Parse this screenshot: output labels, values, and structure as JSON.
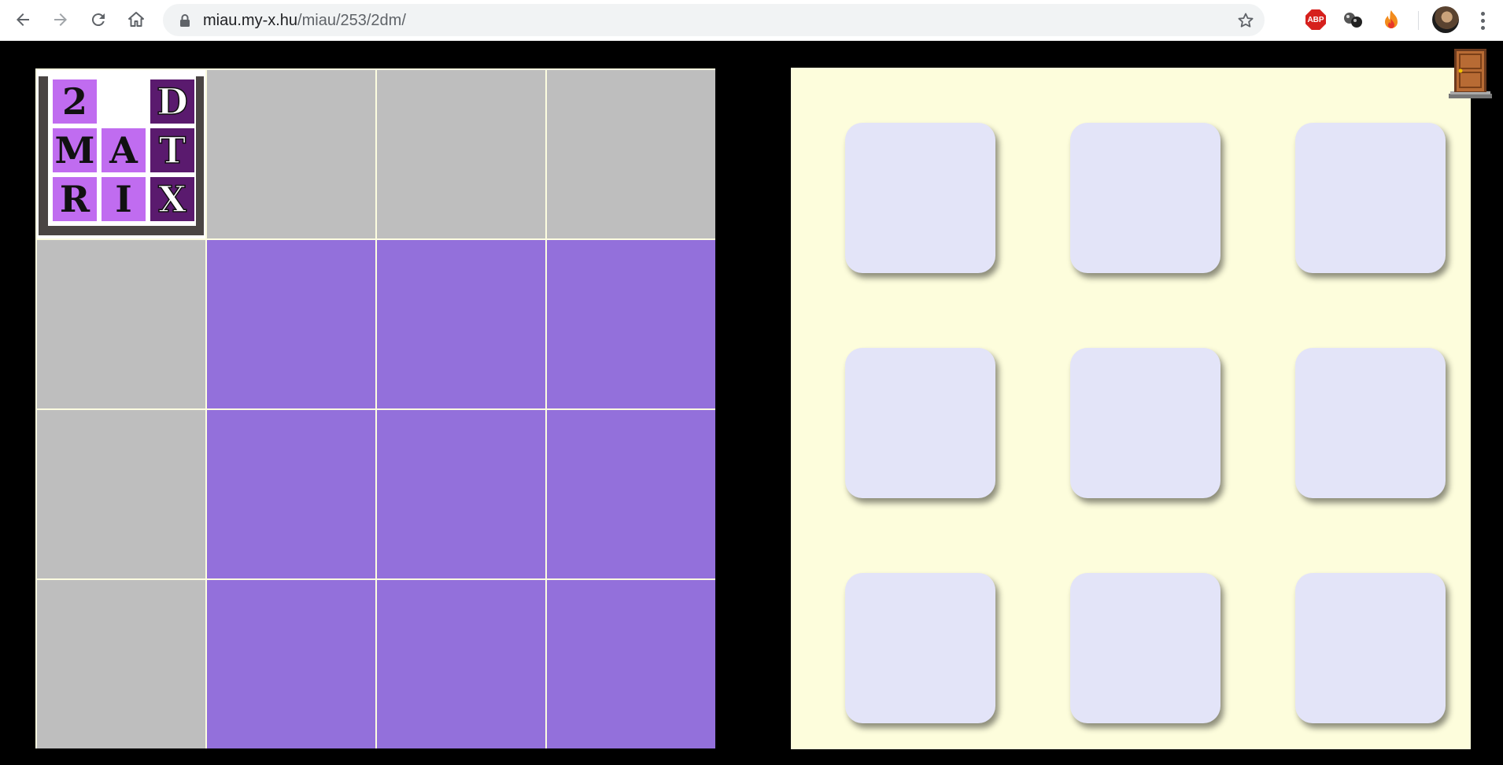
{
  "browser": {
    "url_host": "miau.my-x.hu",
    "url_path": "/miau/253/2dm/",
    "extensions": [
      {
        "name": "adblock-plus-icon",
        "label": "ABP"
      },
      {
        "name": "extension-balls-icon"
      },
      {
        "name": "extension-flame-icon"
      }
    ]
  },
  "logo": {
    "letters": [
      {
        "char": "2",
        "style": "light"
      },
      {
        "char": "",
        "style": "blank"
      },
      {
        "char": "D",
        "style": "dark"
      },
      {
        "char": "M",
        "style": "light"
      },
      {
        "char": "A",
        "style": "light"
      },
      {
        "char": "T",
        "style": "dark"
      },
      {
        "char": "R",
        "style": "light"
      },
      {
        "char": "I",
        "style": "light"
      },
      {
        "char": "X",
        "style": "dark"
      }
    ]
  },
  "matrix": {
    "rows": [
      [
        "logo",
        "grey",
        "grey",
        "grey"
      ],
      [
        "grey",
        "purple",
        "purple",
        "purple"
      ],
      [
        "grey",
        "purple",
        "purple",
        "purple"
      ],
      [
        "grey",
        "purple",
        "purple",
        "purple"
      ]
    ]
  },
  "board": {
    "tile_count": 9
  },
  "colors": {
    "grey_cell": "#bebebe",
    "purple_cell": "#9370db",
    "board_bg": "#fdfddc",
    "tile": "#e3e4f8",
    "logo_light": "#c06cf0",
    "logo_dark": "#5a1a6e"
  }
}
